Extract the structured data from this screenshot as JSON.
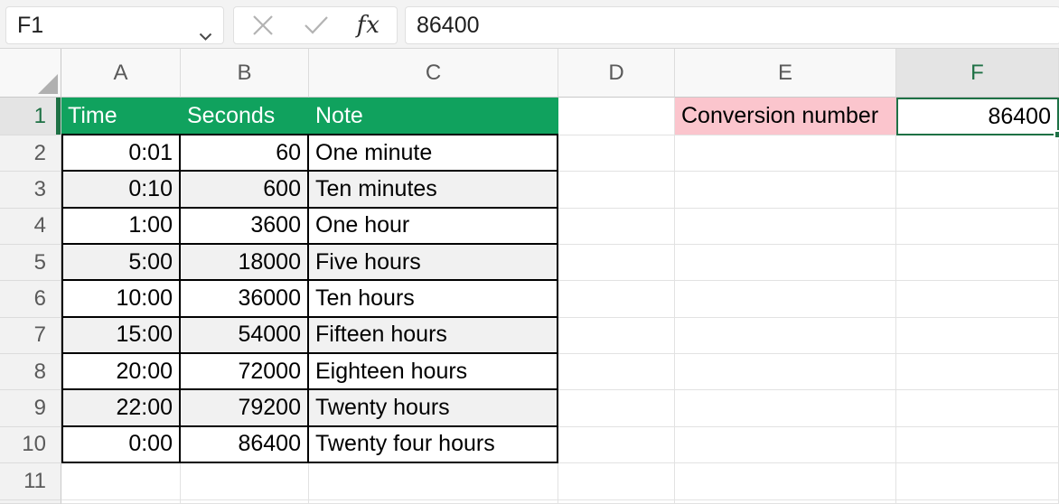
{
  "formula_bar": {
    "cell_reference": "F1",
    "formula_value": "86400"
  },
  "sheet": {
    "column_letters": [
      "A",
      "B",
      "C",
      "D",
      "E",
      "F"
    ],
    "row_numbers": [
      "1",
      "2",
      "3",
      "4",
      "5",
      "6",
      "7",
      "8",
      "9",
      "10",
      "11"
    ],
    "selected_column": "F",
    "selected_row": "1",
    "table": {
      "headers": [
        "Time",
        "Seconds",
        "Note"
      ],
      "rows": [
        [
          "0:01",
          "60",
          "One minute"
        ],
        [
          "0:10",
          "600",
          "Ten minutes"
        ],
        [
          "1:00",
          "3600",
          "One hour"
        ],
        [
          "5:00",
          "18000",
          "Five hours"
        ],
        [
          "10:00",
          "36000",
          "Ten hours"
        ],
        [
          "15:00",
          "54000",
          "Fifteen hours"
        ],
        [
          "20:00",
          "72000",
          "Eighteen hours"
        ],
        [
          "22:00",
          "79200",
          "Twenty hours"
        ],
        [
          "0:00",
          "86400",
          "Twenty four hours"
        ]
      ]
    },
    "conversion": {
      "label": "Conversion number",
      "value": "86400"
    }
  },
  "colors": {
    "table_header_green": "#10A25E",
    "selection_green": "#1E7145",
    "label_pink": "#FBC5CD",
    "banded_row_gray": "#F1F1F1"
  }
}
